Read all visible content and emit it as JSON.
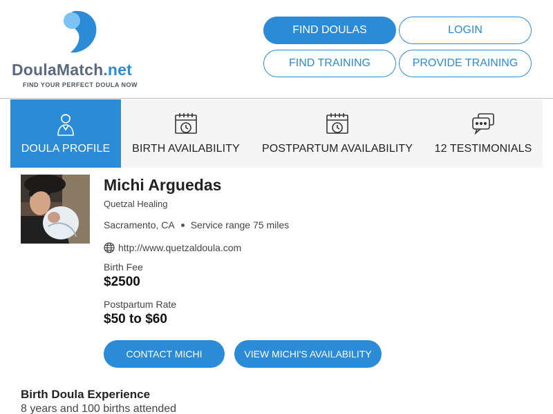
{
  "brand": {
    "name_part1": "Doula",
    "name_part2": "Match",
    "name_part3": ".net",
    "tagline": "FIND YOUR PERFECT DOULA NOW",
    "colors": {
      "primary": "#2b8bd6",
      "light": "#7cc3f3",
      "text": "#5a6a7e"
    }
  },
  "nav": {
    "find_doulas": "FIND DOULAS",
    "login": "LOGIN",
    "find_training": "FIND TRAINING",
    "provide_training": "PROVIDE TRAINING"
  },
  "tabs": [
    {
      "label": "DOULA PROFILE",
      "icon": "doula-profile-icon",
      "active": true
    },
    {
      "label": "BIRTH AVAILABILITY",
      "icon": "calendar-clock-icon",
      "active": false
    },
    {
      "label": "POSTPARTUM AVAILABILITY",
      "icon": "calendar-clock-icon",
      "active": false
    },
    {
      "label": "12 TESTIMONIALS",
      "icon": "chat-bubbles-icon",
      "active": false
    }
  ],
  "profile": {
    "name": "Michi Arguedas",
    "business": "Quetzal Healing",
    "location": "Sacramento, CA",
    "service_range": "Service range 75 miles",
    "website": "http://www.quetzaldoula.com",
    "birth_fee_label": "Birth Fee",
    "birth_fee": "$2500",
    "postpartum_label": "Postpartum Rate",
    "postpartum_rate": "$50 to $60",
    "contact_button": "CONTACT MICHI",
    "availability_button": "VIEW MICHI'S AVAILABILITY"
  },
  "experience": {
    "title": "Birth Doula Experience",
    "text": "8 years and 100 births attended"
  }
}
